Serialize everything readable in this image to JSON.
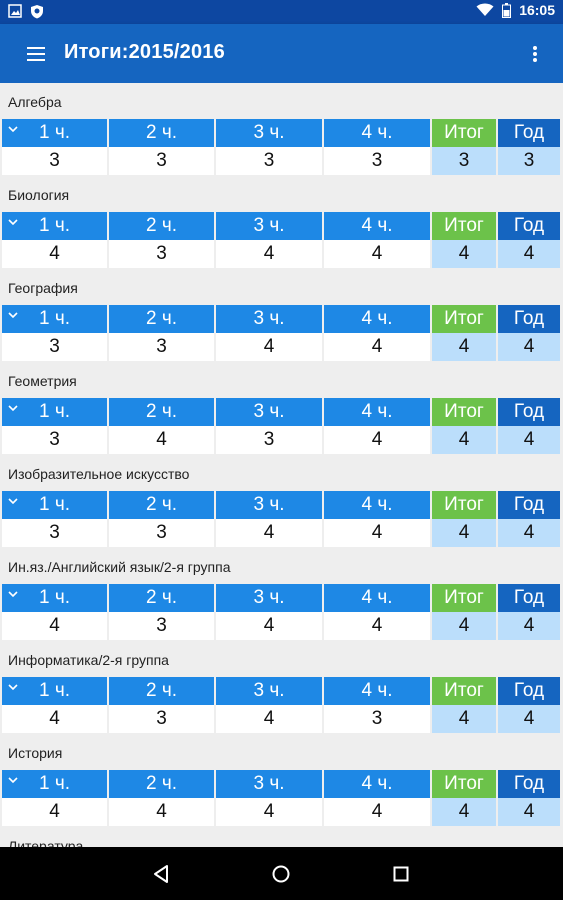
{
  "status_bar": {
    "time": "16:05"
  },
  "app_bar": {
    "title": "Итоги:2015/2016"
  },
  "column_labels": [
    "1 ч.",
    "2 ч.",
    "3 ч.",
    "4 ч.",
    "Итог",
    "Год"
  ],
  "subjects": [
    {
      "name": "Алгебра",
      "grades": [
        "3",
        "3",
        "3",
        "3",
        "3",
        "3"
      ]
    },
    {
      "name": "Биология",
      "grades": [
        "4",
        "3",
        "4",
        "4",
        "4",
        "4"
      ]
    },
    {
      "name": "География",
      "grades": [
        "3",
        "3",
        "4",
        "4",
        "4",
        "4"
      ]
    },
    {
      "name": "Геометрия",
      "grades": [
        "3",
        "4",
        "3",
        "4",
        "4",
        "4"
      ]
    },
    {
      "name": "Изобразительное искусство",
      "grades": [
        "3",
        "3",
        "4",
        "4",
        "4",
        "4"
      ]
    },
    {
      "name": "Ин.яз./Английский язык/2-я группа",
      "grades": [
        "4",
        "3",
        "4",
        "4",
        "4",
        "4"
      ]
    },
    {
      "name": "Информатика/2-я группа",
      "grades": [
        "4",
        "3",
        "4",
        "3",
        "4",
        "4"
      ]
    },
    {
      "name": "История",
      "grades": [
        "4",
        "4",
        "4",
        "4",
        "4",
        "4"
      ]
    },
    {
      "name": "Литература",
      "grades": []
    }
  ],
  "colors": {
    "status_bar": "#0d47a1",
    "app_bar": "#1565c0",
    "quarter_header": "#1e88e5",
    "itog_header": "#6cc24a",
    "god_header": "#1565c0",
    "final_cell_bg": "#bbdefb"
  },
  "icons": {
    "status_left": [
      "image-icon",
      "shield-icon"
    ],
    "status_right": [
      "wifi-icon",
      "battery-icon"
    ],
    "app_bar": [
      "hamburger-menu-icon",
      "more-vert-icon"
    ],
    "column_toggle": "chevron-down-icon",
    "navigation": [
      "back-icon",
      "home-icon",
      "recents-icon"
    ]
  }
}
